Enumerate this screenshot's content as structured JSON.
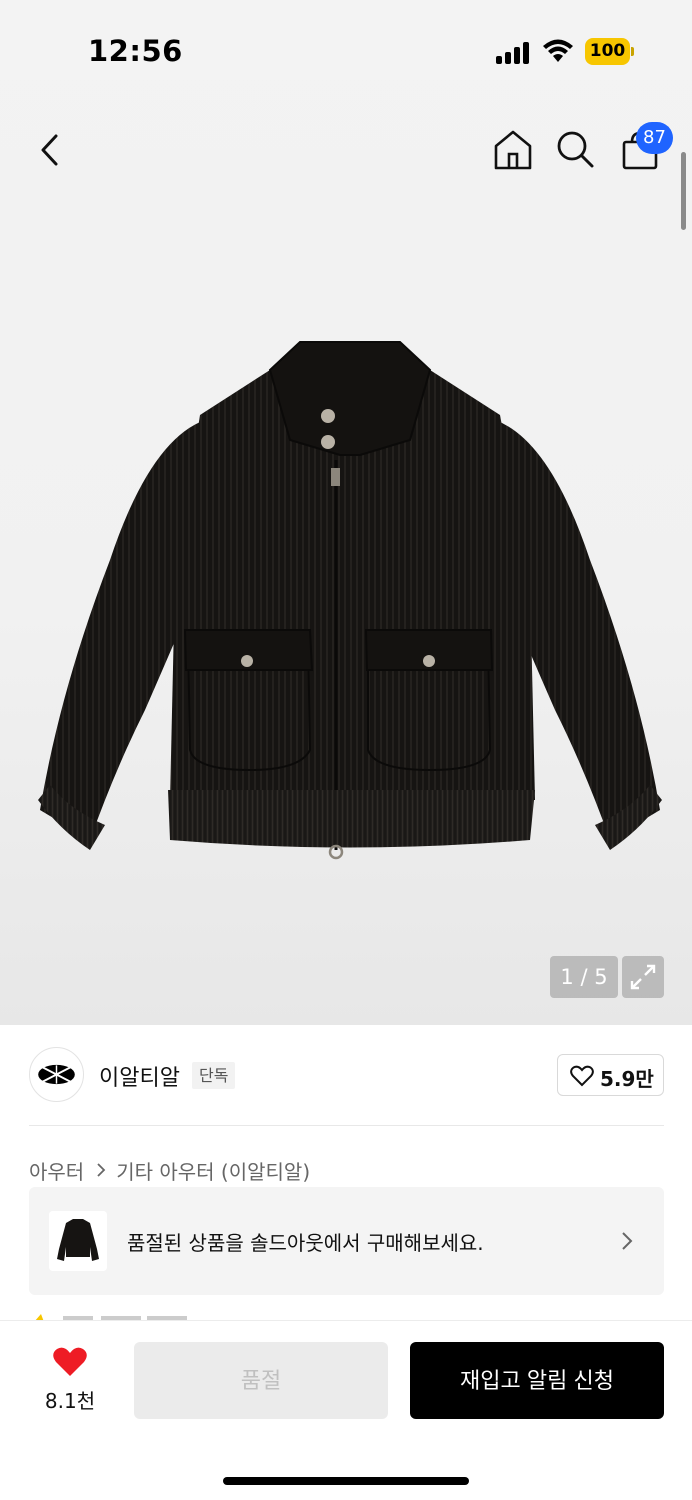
{
  "status_bar": {
    "time": "12:56",
    "battery": "100"
  },
  "header": {
    "cart_count": "87"
  },
  "gallery": {
    "counter": "1 / 5"
  },
  "brand": {
    "name": "이알티알",
    "tag": "단독",
    "likes": "5.9만"
  },
  "breadcrumb": {
    "category": "아우터",
    "subcategory": "기타 아우터 (이알티알)"
  },
  "soldout_banner": {
    "text": "품절된 상품을 솔드아웃에서 구매해보세요."
  },
  "bottom_bar": {
    "wish_count": "8.1천",
    "soldout_label": "품절",
    "restock_label": "재입고 알림 신청"
  },
  "colors": {
    "accent_blue": "#1f64ff",
    "battery_yellow": "#f7c600",
    "heart_red": "#ee1c25"
  }
}
